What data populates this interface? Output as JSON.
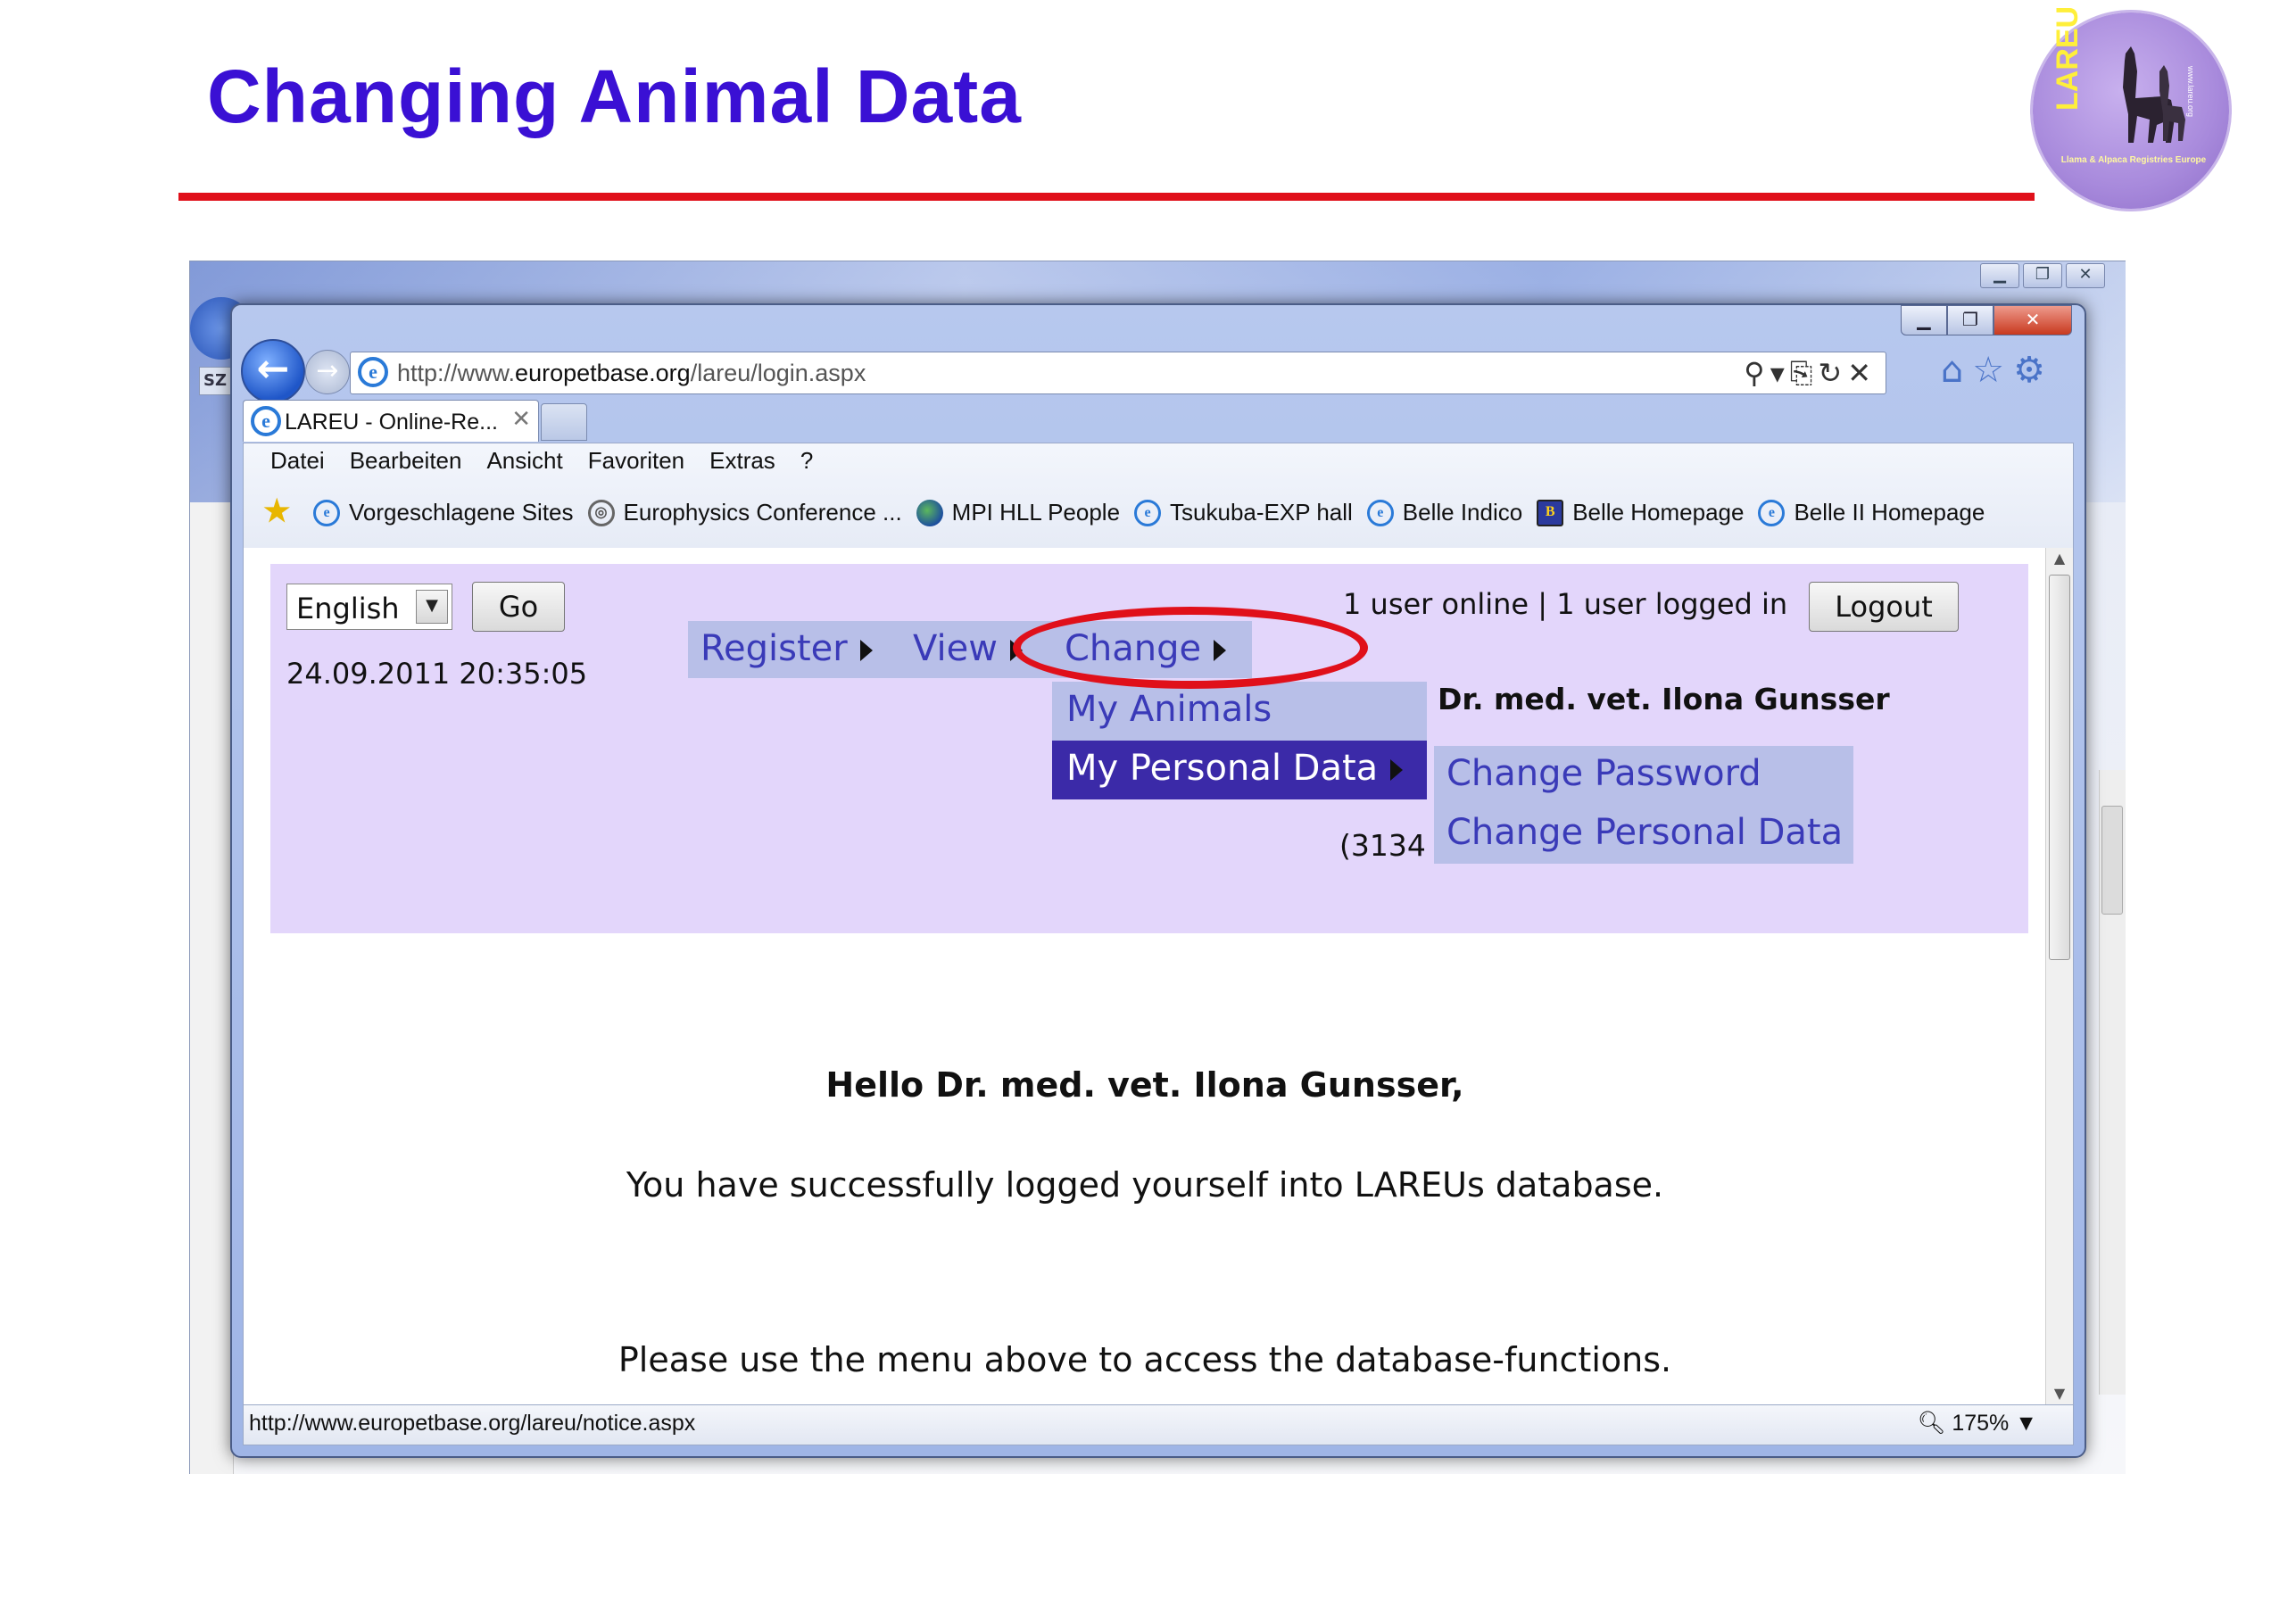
{
  "slide": {
    "title": "Changing Animal Data",
    "logo_text": "LAREU",
    "logo_subtitle": "Llama & Alpaca Registries Europe",
    "logo_url": "www.lareu.org"
  },
  "browser": {
    "back_sidebar_label": "SZ",
    "address": {
      "url_prefix": "http://www.",
      "url_domain": "europetbase.org",
      "url_path": "/lareu/login.aspx"
    },
    "tab": {
      "label": "LAREU - Online-Re...",
      "close": "✕"
    },
    "menu": [
      "Datei",
      "Bearbeiten",
      "Ansicht",
      "Favoriten",
      "Extras",
      "?"
    ],
    "favorites": [
      {
        "label": "Vorgeschlagene Sites",
        "icon": "ie-icon"
      },
      {
        "label": "Europhysics Conference ...",
        "icon": "conference-icon"
      },
      {
        "label": "MPI HLL People",
        "icon": "globe-icon"
      },
      {
        "label": "Tsukuba-EXP hall",
        "icon": "ie-icon"
      },
      {
        "label": "Belle Indico",
        "icon": "ie-icon"
      },
      {
        "label": "Belle Homepage",
        "icon": "belle-icon"
      },
      {
        "label": "Belle II Homepage",
        "icon": "ie-icon"
      }
    ],
    "status_url": "http://www.europetbase.org/lareu/notice.aspx",
    "zoom": "175%"
  },
  "page": {
    "language": "English",
    "go_label": "Go",
    "datetime": "24.09.2011 20:35:05",
    "online_status": "1 user online | 1 user logged in",
    "logout_label": "Logout",
    "nav": {
      "register": "Register",
      "view": "View",
      "change": "Change"
    },
    "change_menu": {
      "my_animals": "My Animals",
      "my_personal_data": "My Personal Data"
    },
    "personal_data_menu": {
      "change_password": "Change Password",
      "change_personal_data": "Change Personal Data"
    },
    "user_name": "Dr. med. vet. Ilona Gunsser",
    "partial_number": "(3134",
    "greeting": "Hello Dr. med. vet. Ilona Gunsser,",
    "message_login": "You have successfully logged yourself into LAREUs database.",
    "message_menu": "Please use the menu above to access the database-functions."
  },
  "colors": {
    "title": "#3a10d4",
    "rule": "#e0101a",
    "panel": "#e3d6fb",
    "menu": "#b8bfe8",
    "menu_text": "#3a3ab8",
    "menu_active": "#3b2aa8",
    "highlight": "#e0101a"
  }
}
